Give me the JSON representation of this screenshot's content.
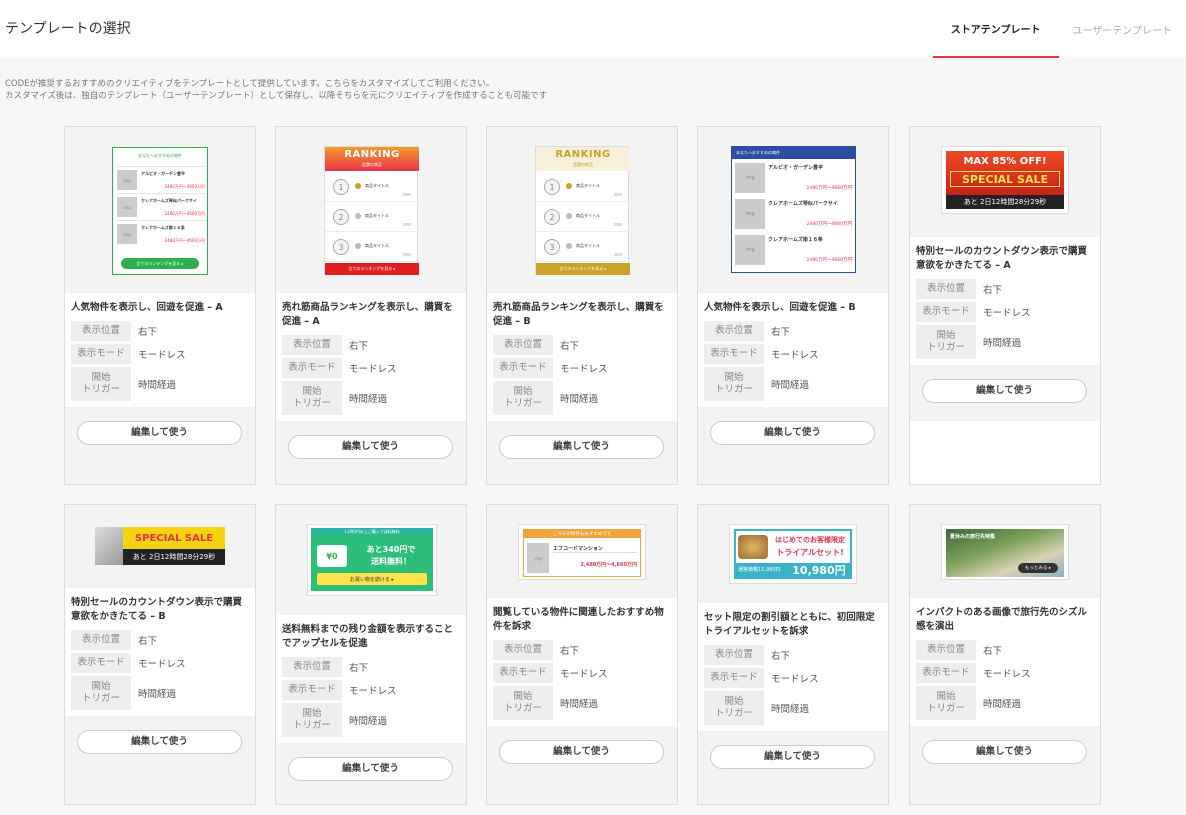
{
  "header": {
    "title": "テンプレートの選択",
    "tabs": [
      {
        "label": "ストアテンプレート",
        "active": true
      },
      {
        "label": "ユーザーテンプレート",
        "active": false
      }
    ]
  },
  "description": {
    "line1": "CODEが推奨するおすすめのクリエイティブをテンプレートとして提供しています。こちらをカスタマイズしてご利用ください。",
    "line2": "カスタマイズ後は、独自のテンプレート（ユーザーテンプレート）として保存し、以降そちらを元にクリエイティブを作成することも可能です"
  },
  "labels": {
    "position": "表示位置",
    "mode": "表示モード",
    "trigger_line1": "開始",
    "trigger_line2": "トリガー",
    "edit_button": "編集して使う"
  },
  "cards": [
    {
      "title": "人気物件を表示し、回遊を促進 – A",
      "position": "右下",
      "mode": "モードレス",
      "trigger": "時間経過"
    },
    {
      "title": "売れ筋商品ランキングを表示し、購買を促進 – A",
      "position": "右下",
      "mode": "モードレス",
      "trigger": "時間経過"
    },
    {
      "title": "売れ筋商品ランキングを表示し、購買を促進 – B",
      "position": "右下",
      "mode": "モードレス",
      "trigger": "時間経過"
    },
    {
      "title": "人気物件を表示し、回遊を促進 – B",
      "position": "右下",
      "mode": "モードレス",
      "trigger": "時間経過"
    },
    {
      "title": "特別セールのカウントダウン表示で購買意欲をかきたてる – A",
      "position": "右下",
      "mode": "モードレス",
      "trigger": "時間経過"
    },
    {
      "title": "特別セールのカウントダウン表示で購買意欲をかきたてる – B",
      "position": "右下",
      "mode": "モードレス",
      "trigger": "時間経過"
    },
    {
      "title": "送料無料までの残り金額を表示することでアップセルを促進",
      "position": "右下",
      "mode": "モードレス",
      "trigger": "時間経過"
    },
    {
      "title": "閲覧している物件に関連したおすすめ物件を訴求",
      "position": "右下",
      "mode": "モードレス",
      "trigger": "時間経過"
    },
    {
      "title": "セット限定の割引額とともに、初回限定トライアルセットを訴求",
      "position": "右下",
      "mode": "モードレス",
      "trigger": "時間経過"
    },
    {
      "title": "インパクトのある画像で旅行先のシズル感を演出",
      "position": "右下",
      "mode": "モードレス",
      "trigger": "時間経過"
    }
  ],
  "thumbs": {
    "t1_header": "あなたへおすすめの物件",
    "t1_items": [
      "アルビオ・ガーデン豊平",
      "クレアホームズ琴似パークサイ",
      "クレアホームズ南１６条"
    ],
    "t1_price": "2480万円〜4660万円",
    "t1_button": "全てのランキングを見る ▸",
    "ranking": "RANKING",
    "ranking_sub": "話題の商品",
    "product": "商品タイトル",
    "ranking_button": "全てのランキングを見る ▸",
    "t4_header": "あなたへおすすめの物件",
    "sale_max": "MAX 85% OFF!",
    "special_sale": "SPECIAL SALE",
    "countdown": "あと 2日12時間28分29秒",
    "free_ship_top": "1,000円以上ご購入で送料無料",
    "free_ship_main": "あと340円で",
    "free_ship_sub": "送料無料！",
    "free_ship_btn": "お買い物を続ける ▸",
    "yen": "¥0",
    "t8_header": "こちらの物件もおすすめです",
    "t8_item": "エフコードマンション",
    "t8_price": "2,480万円〜4,660万円",
    "trial_top": "はじめてのお客様限定",
    "trial_main": "トライアルセット!",
    "trial_old": "通常価格11,980円",
    "trial_price": "10,980円",
    "travel_title": "夏休みの旅行先特集",
    "travel_btn": "もっとみる ▸",
    "img": "img"
  },
  "colors": {
    "accent": "#e8334a",
    "green": "#2bb24c",
    "gold": "#c9a227",
    "blue": "#2c4ea0",
    "orange": "#f2a33a",
    "teal": "#2bb3a3"
  }
}
